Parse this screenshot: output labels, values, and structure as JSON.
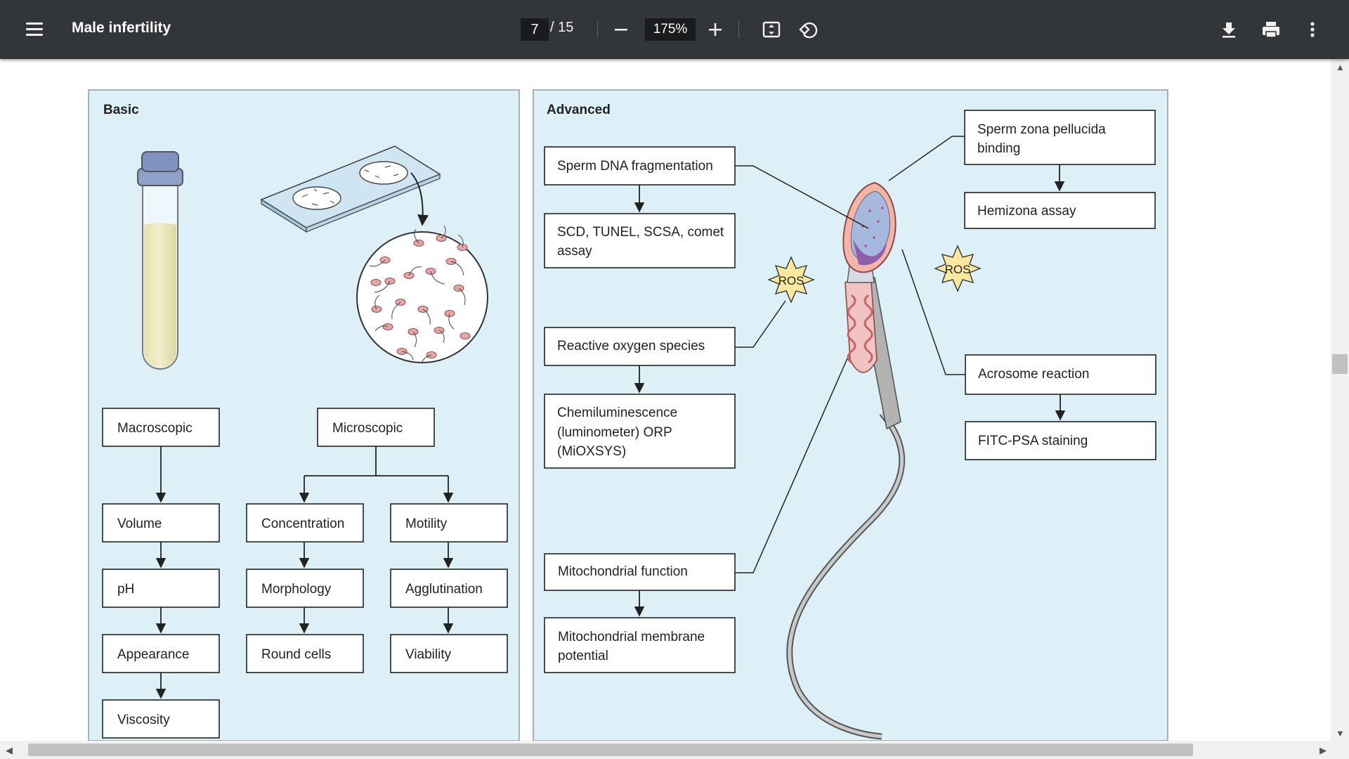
{
  "toolbar": {
    "title": "Male infertility",
    "current_page": "7",
    "total_pages": "/ 15",
    "zoom": "175%"
  },
  "figure": {
    "basic_title": "Basic",
    "advanced_title": "Advanced",
    "macroscopic": "Macroscopic",
    "microscopic": "Microscopic",
    "volume": "Volume",
    "ph": "pH",
    "appearance": "Appearance",
    "viscosity": "Viscosity",
    "concentration": "Concentration",
    "morphology": "Morphology",
    "round_cells": "Round cells",
    "motility": "Motility",
    "agglutination": "Agglutination",
    "viability": "Viability",
    "dna_frag": "Sperm DNA fragmentation",
    "scd_line1": "SCD, TUNEL, SCSA, comet",
    "scd_line2": "assay",
    "ros_full": "Reactive oxygen species",
    "chem_line1": "Chemiluminescence",
    "chem_line2": "(luminometer) ORP",
    "chem_line3": "(MiOXSYS)",
    "mito_func": "Mitochondrial function",
    "mito_mem_line1": "Mitochondrial membrane",
    "mito_mem_line2": "potential",
    "zona_line1": "Sperm zona pellucida",
    "zona_line2": "binding",
    "hemizona": "Hemizona assay",
    "acrosome": "Acrosome reaction",
    "fitc": "FITC-PSA staining",
    "ros_badge_1": "ROS",
    "ros_badge_2": "ROS"
  },
  "colors": {
    "toolbar_bg": "#323639",
    "panel_bg": "#def0f7",
    "box_border": "#222222"
  },
  "icons": [
    "menu-icon",
    "minus-icon",
    "plus-icon",
    "fit-page-icon",
    "rotate-icon",
    "download-icon",
    "print-icon",
    "more-vert-icon"
  ]
}
